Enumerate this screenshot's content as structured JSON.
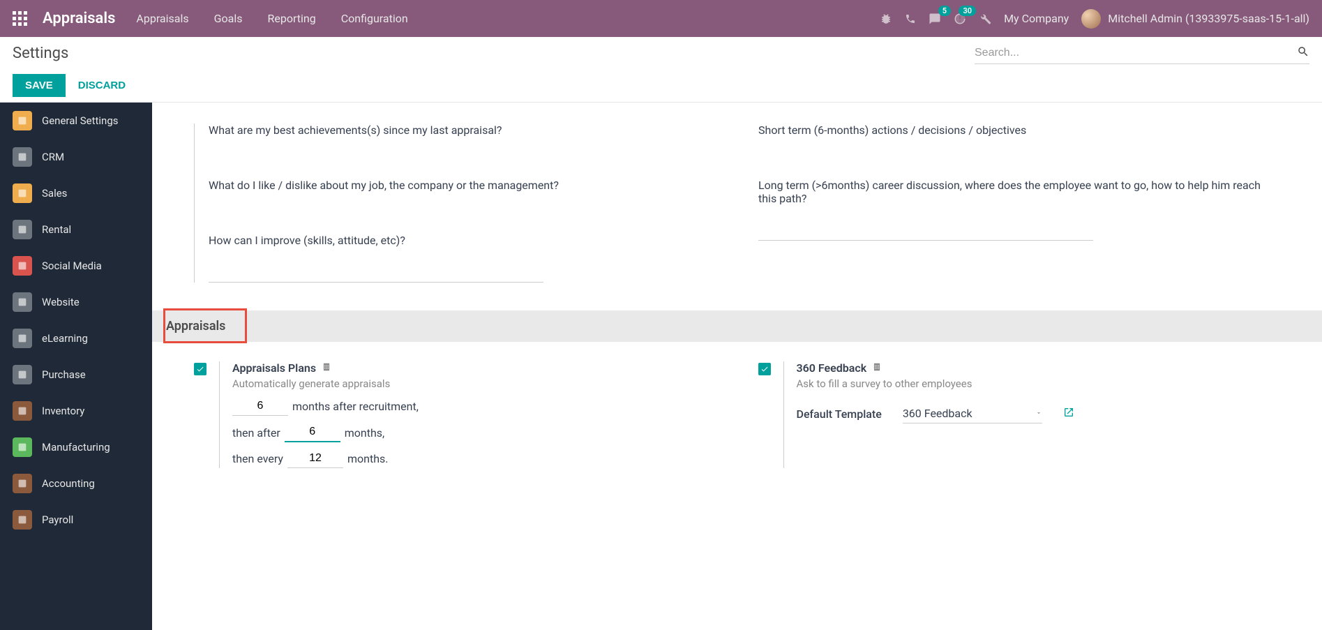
{
  "header": {
    "brand": "Appraisals",
    "menu": [
      "Appraisals",
      "Goals",
      "Reporting",
      "Configuration"
    ],
    "msg_badge": "5",
    "activity_badge": "30",
    "company": "My Company",
    "user": "Mitchell Admin (13933975-saas-15-1-all)"
  },
  "page": {
    "title": "Settings",
    "search_placeholder": "Search...",
    "save": "SAVE",
    "discard": "DISCARD"
  },
  "sidebar": {
    "items": [
      {
        "label": "General Settings",
        "color": "#f0ad4e"
      },
      {
        "label": "CRM",
        "color": "#6c757d"
      },
      {
        "label": "Sales",
        "color": "#f0ad4e"
      },
      {
        "label": "Rental",
        "color": "#6c757d"
      },
      {
        "label": "Social Media",
        "color": "#d9534f"
      },
      {
        "label": "Website",
        "color": "#6c757d"
      },
      {
        "label": "eLearning",
        "color": "#6c757d"
      },
      {
        "label": "Purchase",
        "color": "#6c757d"
      },
      {
        "label": "Inventory",
        "color": "#8b5a3c"
      },
      {
        "label": "Manufacturing",
        "color": "#5cb85c"
      },
      {
        "label": "Accounting",
        "color": "#8b5a3c"
      },
      {
        "label": "Payroll",
        "color": "#8b5a3c"
      }
    ]
  },
  "content": {
    "q1": "What are my best achievements(s) since my last appraisal?",
    "q2": "Short term (6-months) actions / decisions / objectives",
    "q3": "What do I like / dislike about my job, the company or the management?",
    "q4": "Long term (>6months) career discussion, where does the employee want to go, how to help him reach this path?",
    "q5": "How can I improve (skills, attitude, etc)?",
    "section": "Appraisals",
    "plans_title": "Appraisals Plans",
    "plans_desc": "Automatically generate appraisals",
    "plans_num1": "6",
    "plans_txt1": "months after recruitment,",
    "plans_txt2a": "then after",
    "plans_num2": "6",
    "plans_txt2b": "months,",
    "plans_txt3a": "then every",
    "plans_num3": "12",
    "plans_txt3b": "months.",
    "fb_title": "360 Feedback",
    "fb_desc": "Ask to fill a survey to other employees",
    "fb_template_label": "Default Template",
    "fb_template_value": "360 Feedback"
  }
}
